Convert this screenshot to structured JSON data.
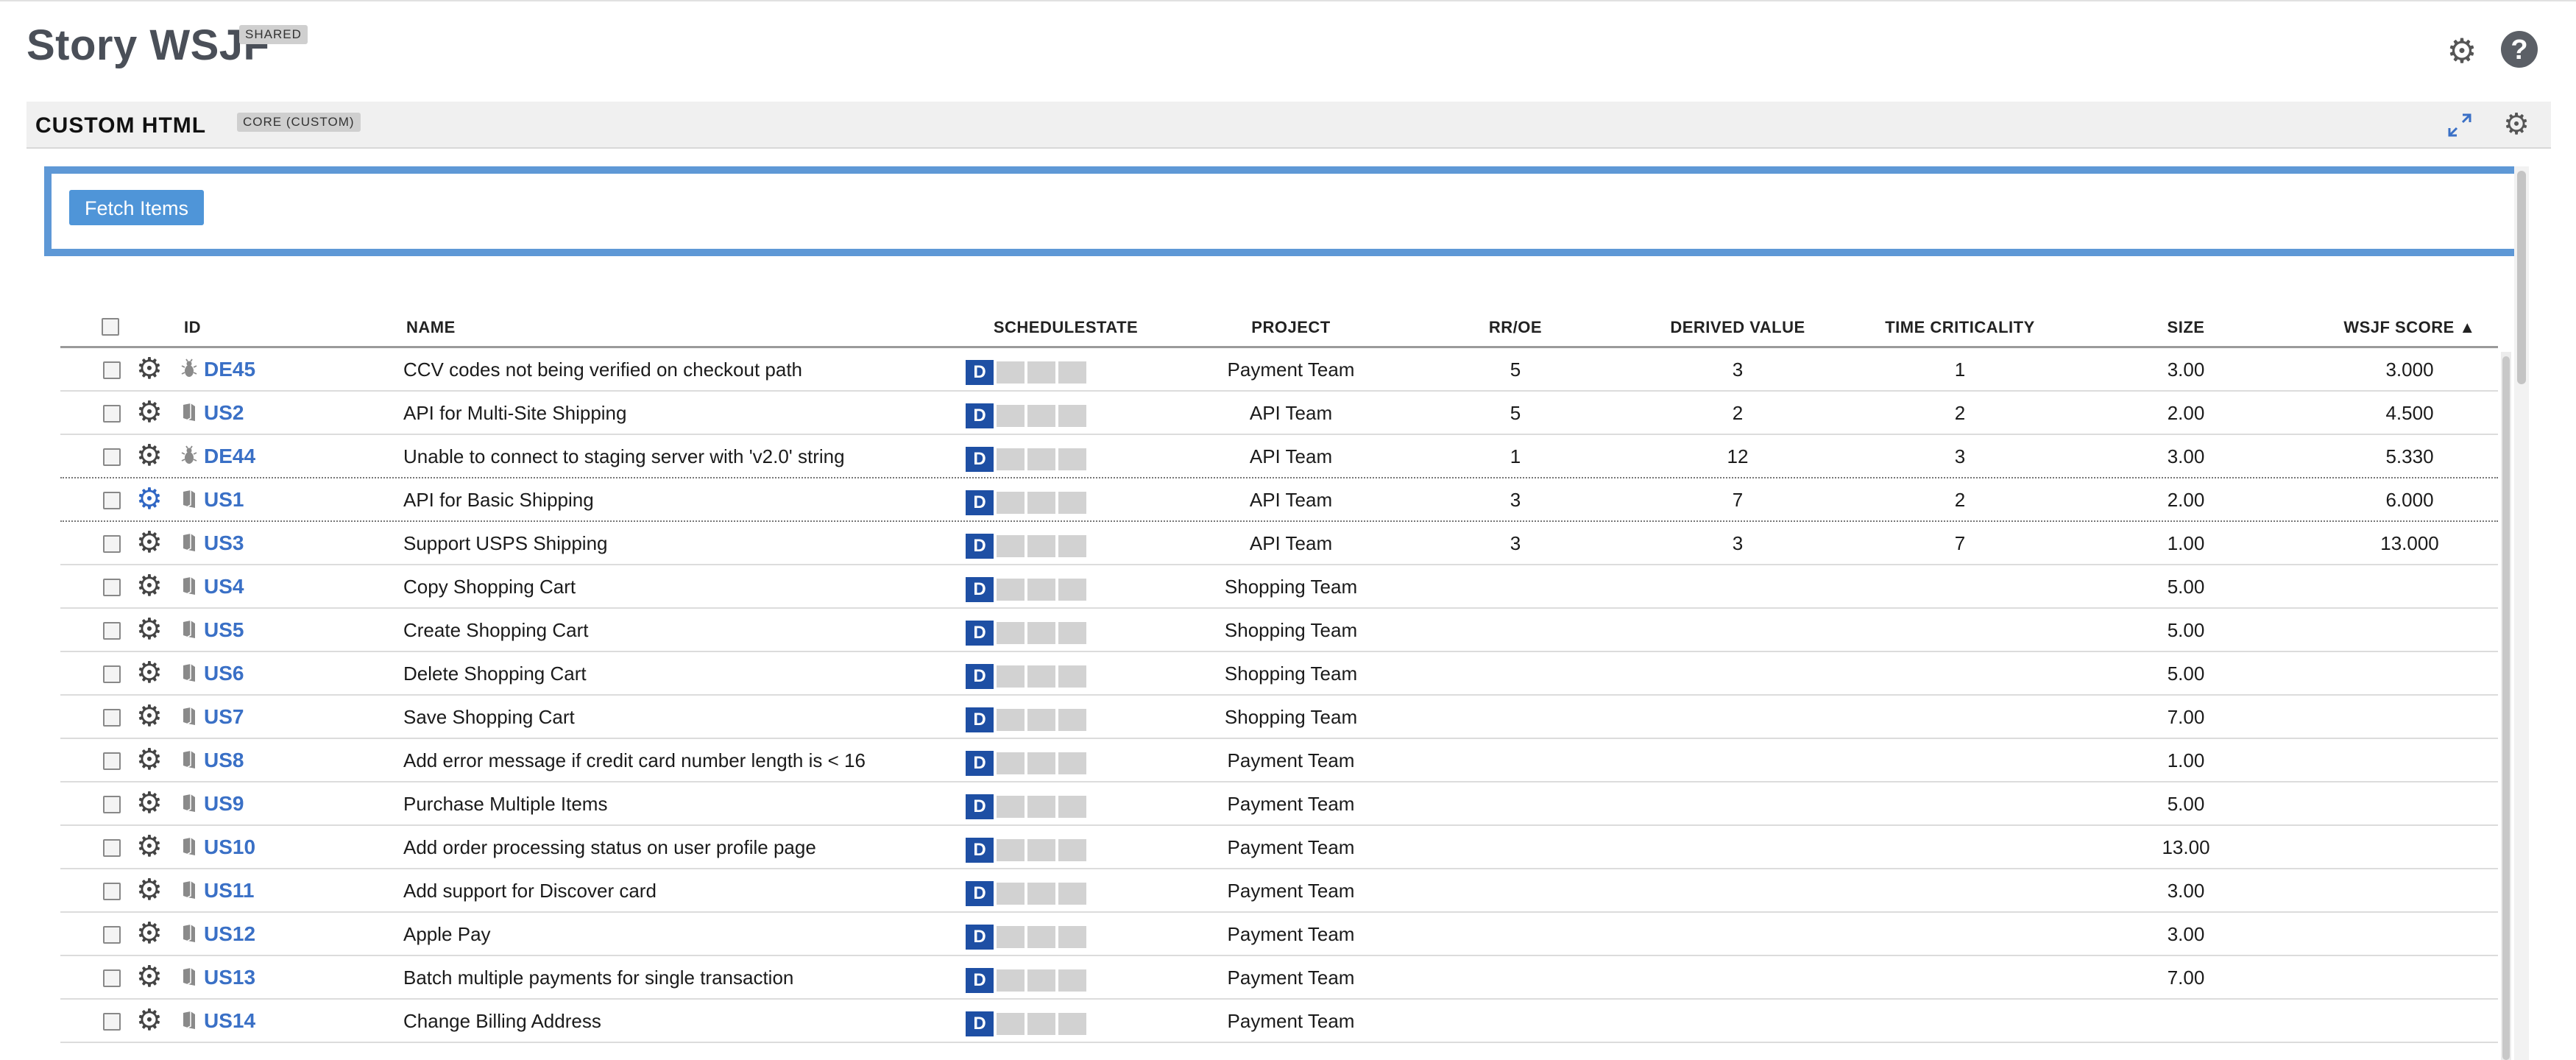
{
  "page": {
    "title": "Story WSJF",
    "badge": "SHARED"
  },
  "panel": {
    "title": "CUSTOM HTML",
    "badge": "CORE (CUSTOM)"
  },
  "fetch_button": "Fetch Items",
  "icons": {
    "gear": "gear-icon",
    "help": "help-icon",
    "expand": "expand-icon",
    "story": "user-story-icon",
    "defect": "defect-icon"
  },
  "colors": {
    "link": "#3a70c6",
    "accent": "#5e98d6",
    "state_defined": "#1e4fa4"
  },
  "columns": {
    "id": "ID",
    "name": "NAME",
    "schedulestate": "SCHEDULESTATE",
    "project": "PROJECT",
    "rroe": "RR/OE",
    "derived": "DERIVED VALUE",
    "timecrit": "TIME CRITICALITY",
    "size": "SIZE",
    "wsjf": "WSJF SCORE ▲"
  },
  "rows": [
    {
      "id": "DE45",
      "type": "defect",
      "name": "CCV codes not being verified on checkout path",
      "state": "D",
      "project": "Payment Team",
      "rroe": "5",
      "derived": "3",
      "timecrit": "1",
      "size": "3.00",
      "wsjf": "3.000"
    },
    {
      "id": "US2",
      "type": "story",
      "name": "API for Multi-Site Shipping",
      "state": "D",
      "project": "API Team",
      "rroe": "5",
      "derived": "2",
      "timecrit": "2",
      "size": "2.00",
      "wsjf": "4.500"
    },
    {
      "id": "DE44",
      "type": "defect",
      "name": "Unable to connect to staging server with 'v2.0' string",
      "state": "D",
      "project": "API Team",
      "rroe": "1",
      "derived": "12",
      "timecrit": "3",
      "size": "3.00",
      "wsjf": "5.330"
    },
    {
      "id": "US1",
      "type": "story",
      "name": "API for Basic Shipping",
      "state": "D",
      "project": "API Team",
      "rroe": "3",
      "derived": "7",
      "timecrit": "2",
      "size": "2.00",
      "wsjf": "6.000"
    },
    {
      "id": "US3",
      "type": "story",
      "name": "Support USPS Shipping",
      "state": "D",
      "project": "API Team",
      "rroe": "3",
      "derived": "3",
      "timecrit": "7",
      "size": "1.00",
      "wsjf": "13.000"
    },
    {
      "id": "US4",
      "type": "story",
      "name": "Copy Shopping Cart",
      "state": "D",
      "project": "Shopping Team",
      "rroe": "",
      "derived": "",
      "timecrit": "",
      "size": "5.00",
      "wsjf": ""
    },
    {
      "id": "US5",
      "type": "story",
      "name": "Create Shopping Cart",
      "state": "D",
      "project": "Shopping Team",
      "rroe": "",
      "derived": "",
      "timecrit": "",
      "size": "5.00",
      "wsjf": ""
    },
    {
      "id": "US6",
      "type": "story",
      "name": "Delete Shopping Cart",
      "state": "D",
      "project": "Shopping Team",
      "rroe": "",
      "derived": "",
      "timecrit": "",
      "size": "5.00",
      "wsjf": ""
    },
    {
      "id": "US7",
      "type": "story",
      "name": "Save Shopping Cart",
      "state": "D",
      "project": "Shopping Team",
      "rroe": "",
      "derived": "",
      "timecrit": "",
      "size": "7.00",
      "wsjf": ""
    },
    {
      "id": "US8",
      "type": "story",
      "name": "Add error message if credit card number length is < 16",
      "state": "D",
      "project": "Payment Team",
      "rroe": "",
      "derived": "",
      "timecrit": "",
      "size": "1.00",
      "wsjf": ""
    },
    {
      "id": "US9",
      "type": "story",
      "name": "Purchase Multiple Items",
      "state": "D",
      "project": "Payment Team",
      "rroe": "",
      "derived": "",
      "timecrit": "",
      "size": "5.00",
      "wsjf": ""
    },
    {
      "id": "US10",
      "type": "story",
      "name": "Add order processing status on user profile page",
      "state": "D",
      "project": "Payment Team",
      "rroe": "",
      "derived": "",
      "timecrit": "",
      "size": "13.00",
      "wsjf": ""
    },
    {
      "id": "US11",
      "type": "story",
      "name": "Add support for Discover card",
      "state": "D",
      "project": "Payment Team",
      "rroe": "",
      "derived": "",
      "timecrit": "",
      "size": "3.00",
      "wsjf": ""
    },
    {
      "id": "US12",
      "type": "story",
      "name": "Apple Pay",
      "state": "D",
      "project": "Payment Team",
      "rroe": "",
      "derived": "",
      "timecrit": "",
      "size": "3.00",
      "wsjf": ""
    },
    {
      "id": "US13",
      "type": "story",
      "name": "Batch multiple payments for single transaction",
      "state": "D",
      "project": "Payment Team",
      "rroe": "",
      "derived": "",
      "timecrit": "",
      "size": "7.00",
      "wsjf": ""
    },
    {
      "id": "US14",
      "type": "story",
      "name": "Change Billing Address",
      "state": "D",
      "project": "Payment Team",
      "rroe": "",
      "derived": "",
      "timecrit": "",
      "size": "",
      "wsjf": ""
    }
  ]
}
